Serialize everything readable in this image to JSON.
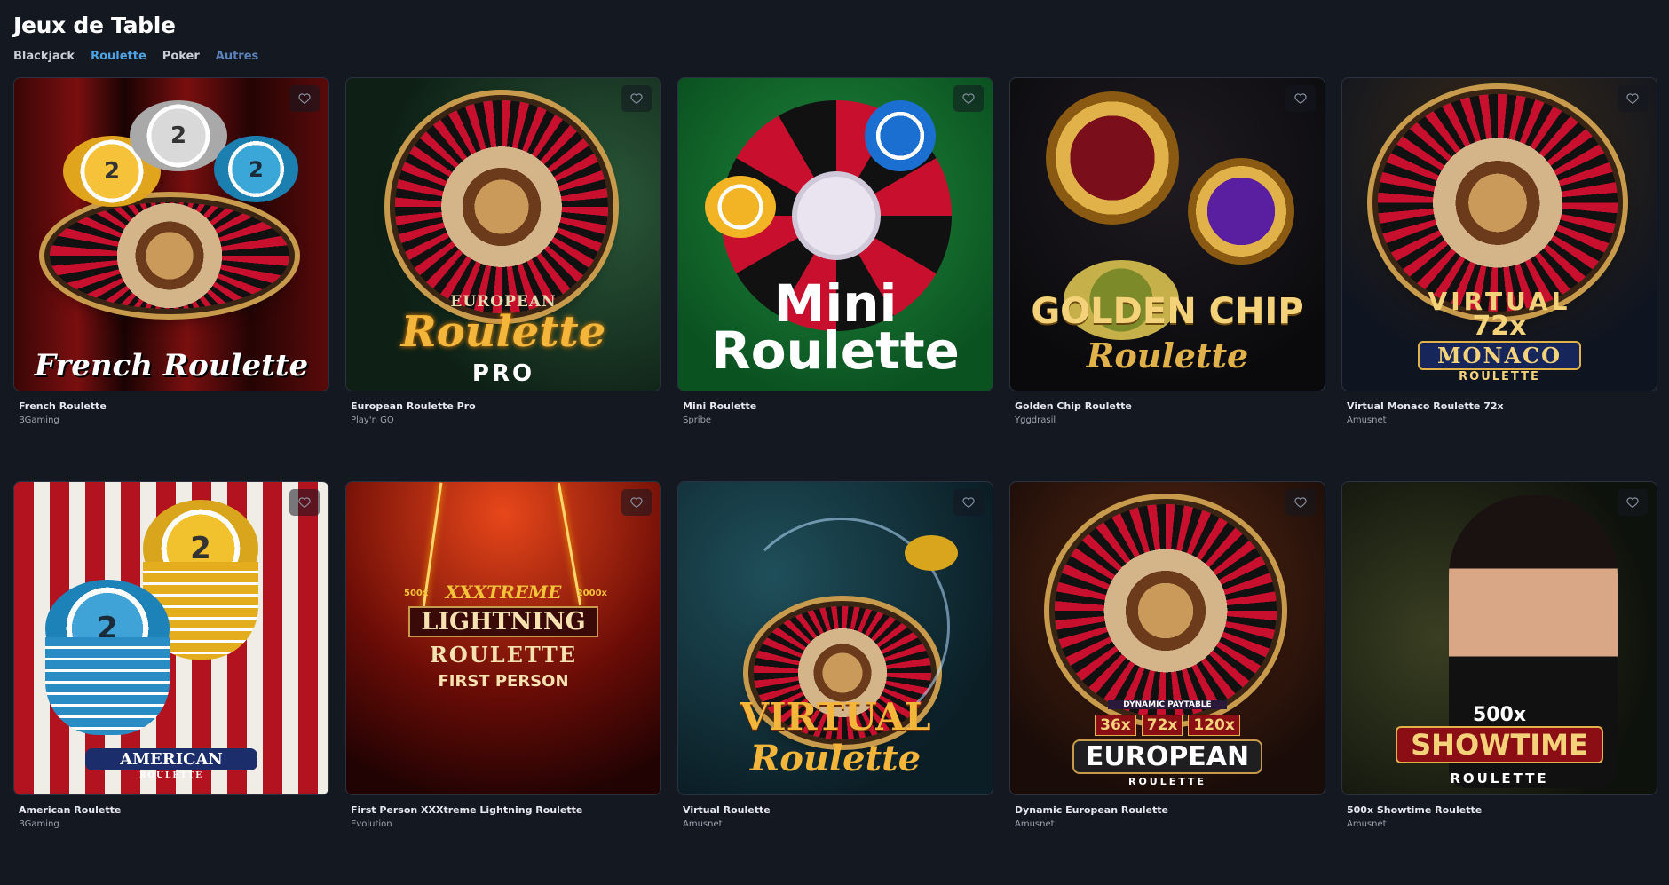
{
  "header": {
    "title": "Jeux de Table"
  },
  "tabs": [
    {
      "label": "Blackjack"
    },
    {
      "label": "Roulette"
    },
    {
      "label": "Poker"
    },
    {
      "label": "Autres"
    }
  ],
  "games": [
    {
      "name": "French Roulette",
      "provider": "BGaming",
      "art_text": "French Roulette"
    },
    {
      "name": "European Roulette Pro",
      "provider": "Play'n GO",
      "art_text_top": "EUROPEAN",
      "art_text_mid": "Roulette",
      "art_text_bottom": "PRO"
    },
    {
      "name": "Mini Roulette",
      "provider": "Spribe",
      "art_text_top": "Mini",
      "art_text_bottom": "Roulette"
    },
    {
      "name": "Golden Chip Roulette",
      "provider": "Yggdrasil",
      "art_text_top": "GOLDEN CHIP",
      "art_text_bottom": "Roulette"
    },
    {
      "name": "Virtual Monaco Roulette 72x",
      "provider": "Amusnet",
      "art_text_top": "VIRTUAL",
      "art_text_mid": "72x",
      "art_text_bottom": "MONACO",
      "art_text_sub": "ROULETTE"
    },
    {
      "name": "American Roulette",
      "provider": "BGaming",
      "art_text": "AMERICAN",
      "art_text_sub": "ROULETTE"
    },
    {
      "name": "First Person XXXtreme Lightning Roulette",
      "provider": "Evolution",
      "art_text_top": "XXXTREME",
      "art_text_mid": "LIGHTNING",
      "art_text_bottom": "ROULETTE",
      "art_text_sub": "FIRST PERSON",
      "art_left": "500x",
      "art_right": "2000x"
    },
    {
      "name": "Virtual Roulette",
      "provider": "Amusnet",
      "art_text_top": "VIRTUAL",
      "art_text_bottom": "Roulette"
    },
    {
      "name": "Dynamic European Roulette",
      "provider": "Amusnet",
      "art_text_top": "DYNAMIC PAYTABLE",
      "art_m1": "36x",
      "art_m2": "72x",
      "art_m3": "120x",
      "art_text_bottom": "EUROPEAN",
      "art_text_sub": "ROULETTE"
    },
    {
      "name": "500x Showtime Roulette",
      "provider": "Amusnet",
      "art_text_top": "500x",
      "art_text_bottom": "SHOWTIME",
      "art_text_sub": "ROULETTE"
    }
  ],
  "colors": {
    "background": "#141821",
    "active_tab": "#4fa3e3",
    "muted_tab": "#5b82b8"
  },
  "icons": {
    "favorite": "heart-outline-icon"
  }
}
